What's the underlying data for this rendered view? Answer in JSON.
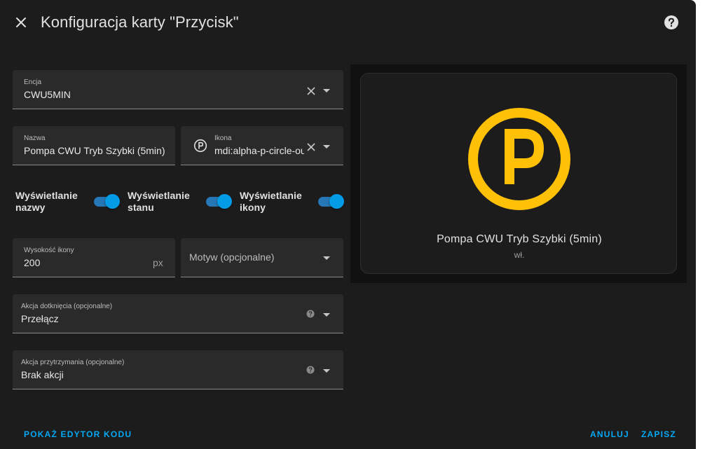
{
  "dialog": {
    "title": "Konfiguracja karty \"Przycisk\""
  },
  "form": {
    "entity": {
      "label": "Encja",
      "value": "CWU5MIN"
    },
    "name": {
      "label": "Nazwa",
      "value": "Pompa CWU Tryb Szybki (5min)"
    },
    "icon": {
      "label": "Ikona",
      "value": "mdi:alpha-p-circle-outline"
    },
    "toggles": [
      {
        "label_line1": "Wyświetlanie",
        "label_line2": "nazwy",
        "enabled": true
      },
      {
        "label_line1": "Wyświetlanie",
        "label_line2": "stanu",
        "enabled": true
      },
      {
        "label_line1": "Wyświetlanie",
        "label_line2": "ikony",
        "enabled": true
      }
    ],
    "icon_height": {
      "label": "Wysokość ikony",
      "value": "200",
      "suffix": "px"
    },
    "theme": {
      "placeholder": "Motyw (opcjonalne)"
    },
    "tap_action": {
      "label": "Akcja dotknięcia (opcjonalne)",
      "value": "Przełącz"
    },
    "hold_action": {
      "label": "Akcja przytrzymania (opcjonalne)",
      "value": "Brak akcji"
    }
  },
  "preview": {
    "name": "Pompa CWU Tryb Szybki (5min)",
    "state": "wł.",
    "icon_color": "#ffc107"
  },
  "footer": {
    "code_editor": "POKAŻ EDYTOR KODU",
    "cancel": "ANULUJ",
    "save": "ZAPISZ"
  },
  "colors": {
    "accent": "#03a9f4",
    "background": "#1c1c1c",
    "field": "#2a2a2a"
  }
}
